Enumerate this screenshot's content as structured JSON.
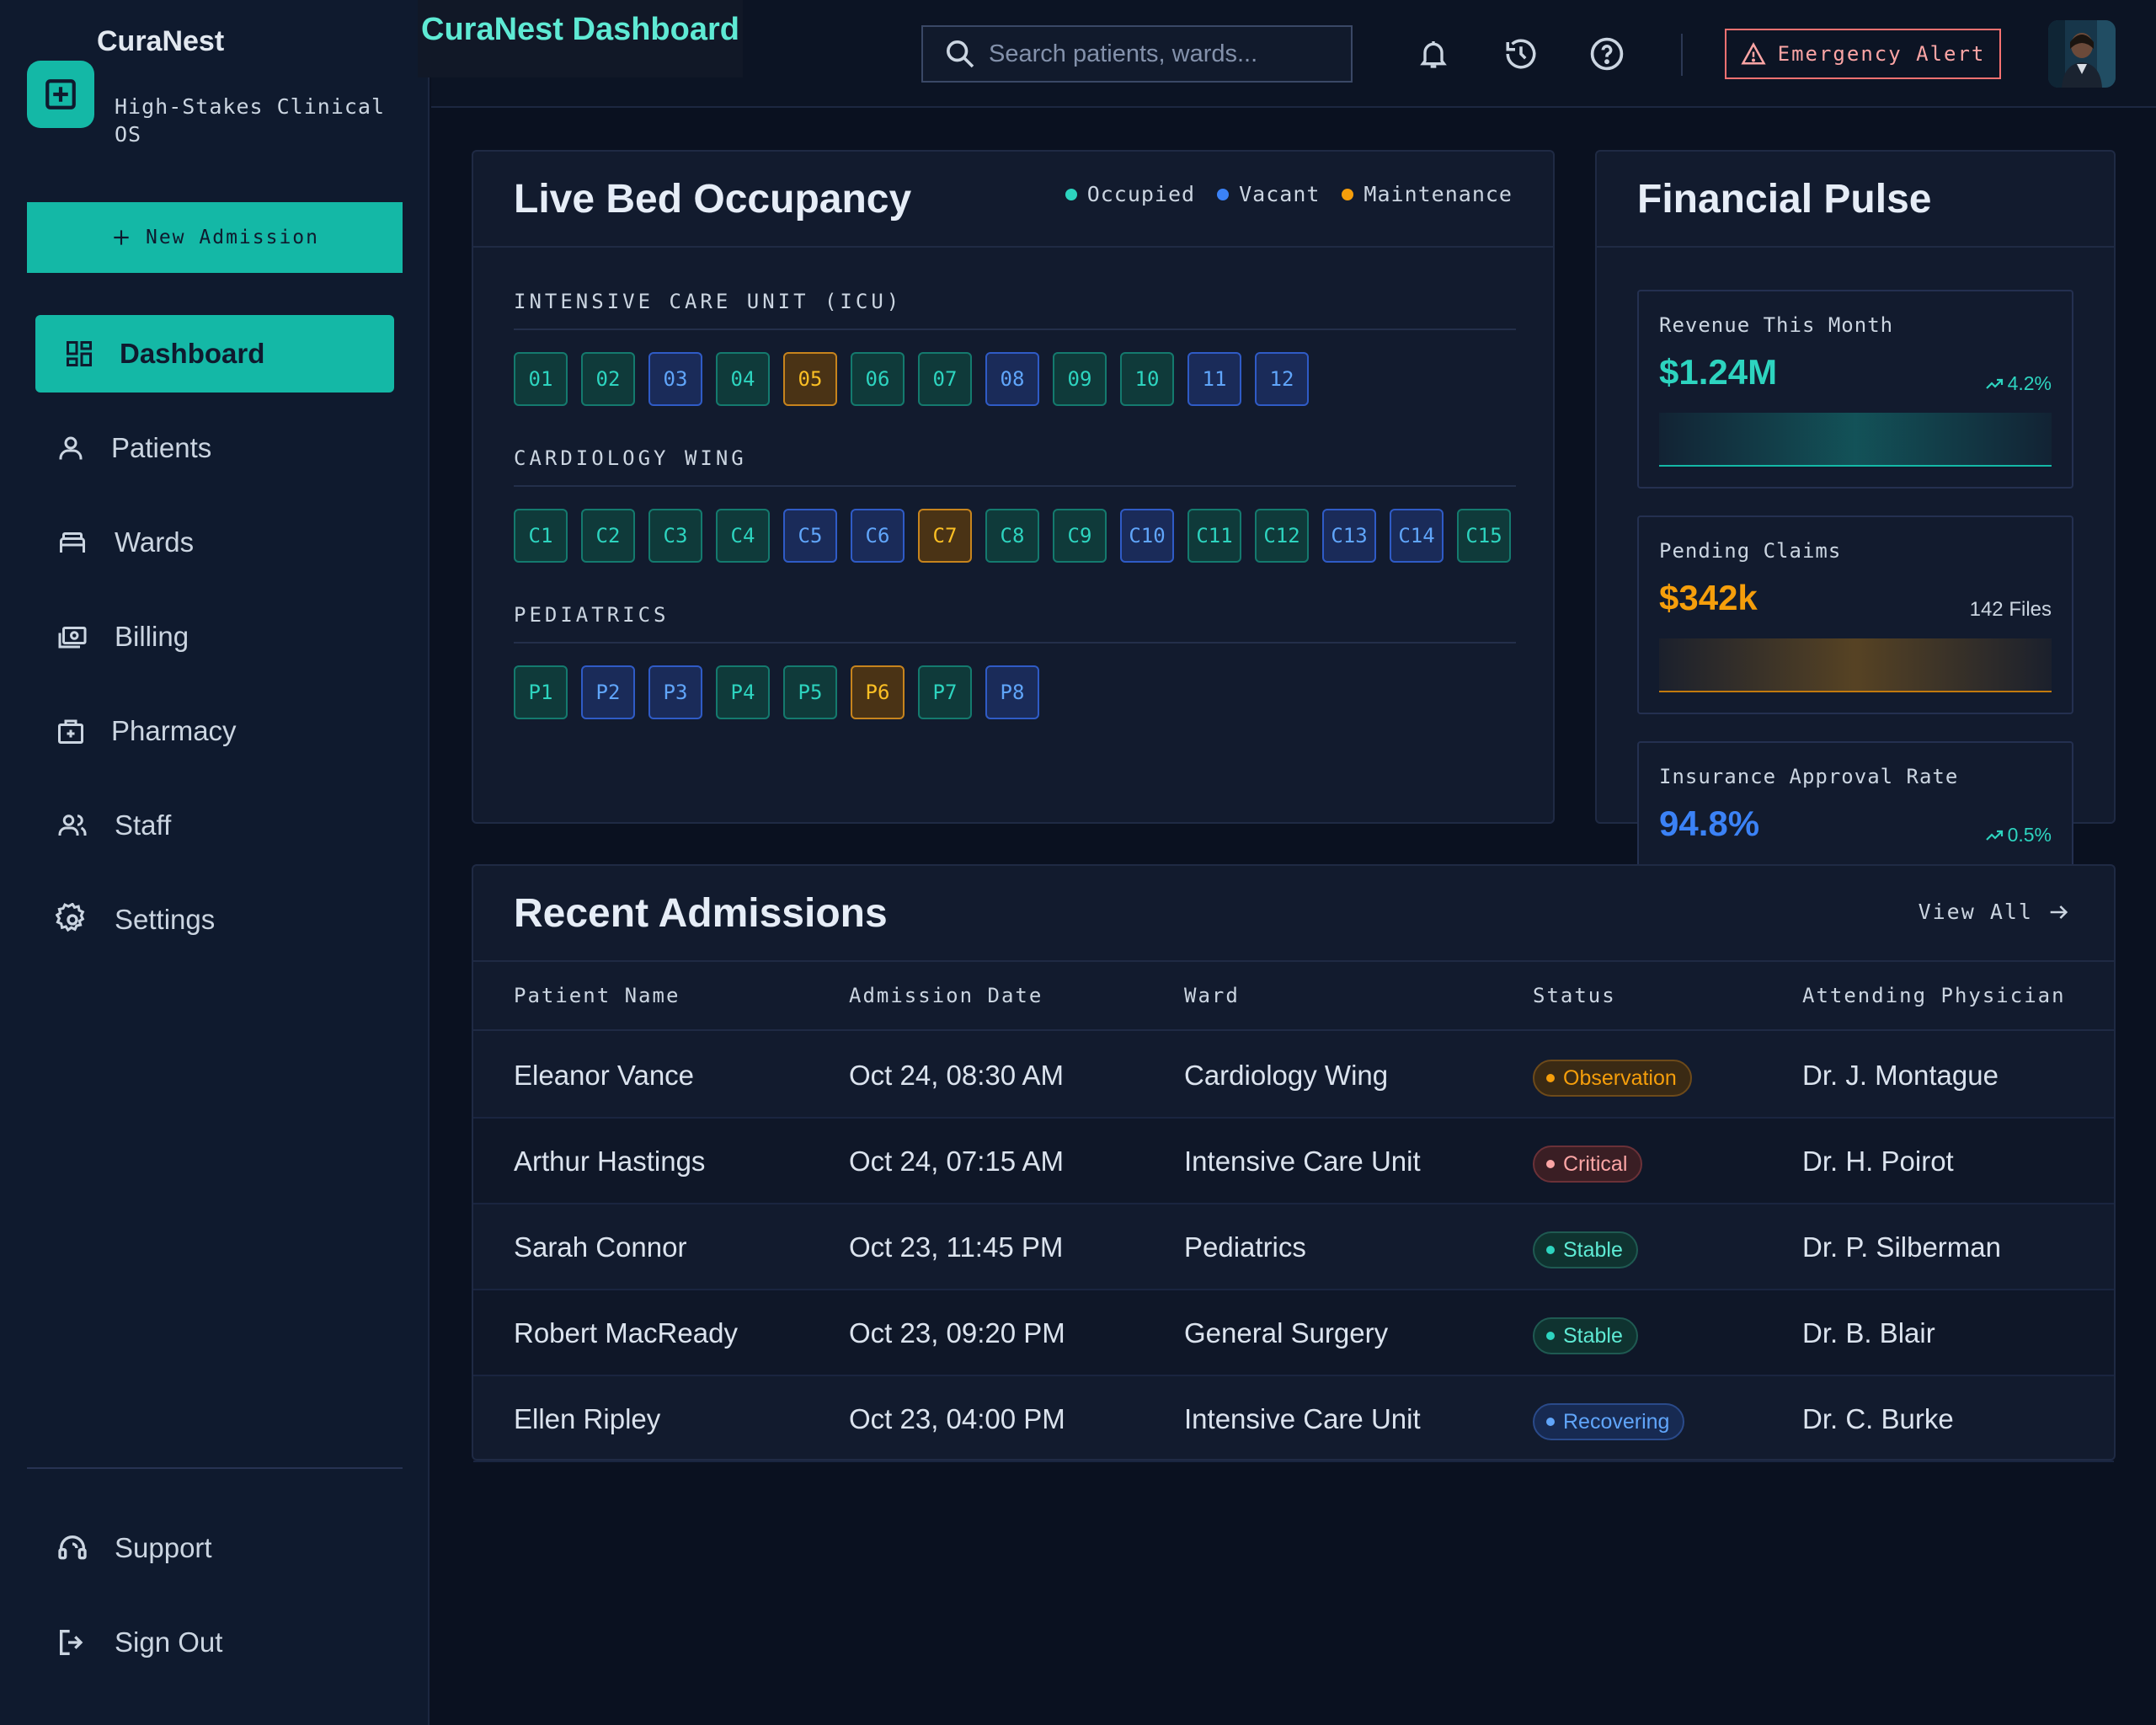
{
  "brand": {
    "name": "CuraNest",
    "subtitle": "High-Stakes Clinical OS"
  },
  "sidebar": {
    "new_admission_label": "New Admission",
    "items": [
      {
        "label": "Dashboard",
        "icon": "dashboard-icon",
        "active": true
      },
      {
        "label": "Patients",
        "icon": "user-icon"
      },
      {
        "label": "Wards",
        "icon": "bed-icon"
      },
      {
        "label": "Billing",
        "icon": "billing-icon"
      },
      {
        "label": "Pharmacy",
        "icon": "pharmacy-icon"
      },
      {
        "label": "Staff",
        "icon": "staff-icon"
      },
      {
        "label": "Settings",
        "icon": "gear-icon"
      }
    ],
    "bottom_items": [
      {
        "label": "Support",
        "icon": "support-icon"
      },
      {
        "label": "Sign Out",
        "icon": "sign-out-icon"
      }
    ]
  },
  "header": {
    "title": "CuraNest Dashboard",
    "search_placeholder": "Search patients, wards...",
    "emergency_label": "Emergency Alert"
  },
  "occupancy": {
    "title": "Live Bed Occupancy",
    "legend": {
      "occupied": "Occupied",
      "vacant": "Vacant",
      "maintenance": "Maintenance"
    },
    "colors": {
      "occupied": "#2dd4bf",
      "vacant": "#3b82f6",
      "maintenance": "#f59e0b"
    },
    "wards": [
      {
        "name": "INTENSIVE CARE UNIT (ICU)",
        "beds": [
          {
            "id": "01",
            "status": "occupied"
          },
          {
            "id": "02",
            "status": "occupied"
          },
          {
            "id": "03",
            "status": "vacant"
          },
          {
            "id": "04",
            "status": "occupied"
          },
          {
            "id": "05",
            "status": "maintenance"
          },
          {
            "id": "06",
            "status": "occupied"
          },
          {
            "id": "07",
            "status": "occupied"
          },
          {
            "id": "08",
            "status": "vacant"
          },
          {
            "id": "09",
            "status": "occupied"
          },
          {
            "id": "10",
            "status": "occupied"
          },
          {
            "id": "11",
            "status": "vacant"
          },
          {
            "id": "12",
            "status": "vacant"
          }
        ]
      },
      {
        "name": "CARDIOLOGY WING",
        "beds": [
          {
            "id": "C1",
            "status": "occupied"
          },
          {
            "id": "C2",
            "status": "occupied"
          },
          {
            "id": "C3",
            "status": "occupied"
          },
          {
            "id": "C4",
            "status": "occupied"
          },
          {
            "id": "C5",
            "status": "vacant"
          },
          {
            "id": "C6",
            "status": "vacant"
          },
          {
            "id": "C7",
            "status": "maintenance"
          },
          {
            "id": "C8",
            "status": "occupied"
          },
          {
            "id": "C9",
            "status": "occupied"
          },
          {
            "id": "C10",
            "status": "vacant"
          },
          {
            "id": "C11",
            "status": "occupied"
          },
          {
            "id": "C12",
            "status": "occupied"
          },
          {
            "id": "C13",
            "status": "vacant"
          },
          {
            "id": "C14",
            "status": "vacant"
          },
          {
            "id": "C15",
            "status": "occupied"
          }
        ]
      },
      {
        "name": "PEDIATRICS",
        "beds": [
          {
            "id": "P1",
            "status": "occupied"
          },
          {
            "id": "P2",
            "status": "vacant"
          },
          {
            "id": "P3",
            "status": "vacant"
          },
          {
            "id": "P4",
            "status": "occupied"
          },
          {
            "id": "P5",
            "status": "occupied"
          },
          {
            "id": "P6",
            "status": "maintenance"
          },
          {
            "id": "P7",
            "status": "occupied"
          },
          {
            "id": "P8",
            "status": "vacant"
          }
        ]
      }
    ]
  },
  "financial": {
    "title": "Financial Pulse",
    "revenue": {
      "label": "Revenue This Month",
      "value": "$1.24M",
      "trend": "4.2%",
      "color": "#2dd4bf"
    },
    "claims": {
      "label": "Pending Claims",
      "value": "$342k",
      "note": "142 Files",
      "color": "#f59e0b"
    },
    "insurance": {
      "label": "Insurance Approval Rate",
      "value": "94.8%",
      "trend": "0.5%",
      "color": "#3b82f6",
      "progress": 0.948
    }
  },
  "admissions": {
    "title": "Recent Admissions",
    "view_all_label": "View All",
    "columns": [
      "Patient Name",
      "Admission Date",
      "Ward",
      "Status",
      "Attending Physician"
    ],
    "rows": [
      {
        "name": "Eleanor Vance",
        "date": "Oct 24, 08:30 AM",
        "ward": "Cardiology Wing",
        "status": "Observation",
        "status_type": "observation",
        "physician": "Dr. J. Montague"
      },
      {
        "name": "Arthur Hastings",
        "date": "Oct 24, 07:15 AM",
        "ward": "Intensive Care Unit",
        "status": "Critical",
        "status_type": "critical",
        "physician": "Dr. H. Poirot"
      },
      {
        "name": "Sarah Connor",
        "date": "Oct 23, 11:45 PM",
        "ward": "Pediatrics",
        "status": "Stable",
        "status_type": "stable",
        "physician": "Dr. P. Silberman"
      },
      {
        "name": "Robert MacReady",
        "date": "Oct 23, 09:20 PM",
        "ward": "General Surgery",
        "status": "Stable",
        "status_type": "stable",
        "physician": "Dr. B. Blair"
      },
      {
        "name": "Ellen Ripley",
        "date": "Oct 23, 04:00 PM",
        "ward": "Intensive Care Unit",
        "status": "Recovering",
        "status_type": "recovering",
        "physician": "Dr. C. Burke"
      }
    ]
  }
}
